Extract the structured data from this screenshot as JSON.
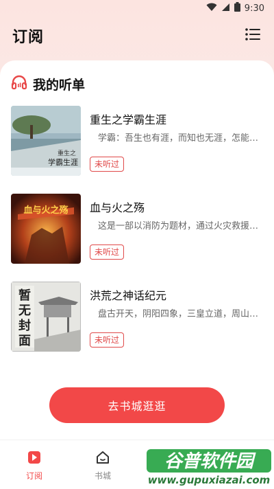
{
  "status_bar": {
    "time": "9:30",
    "icons": [
      "wifi-icon",
      "signal-icon",
      "battery-icon"
    ]
  },
  "header": {
    "title": "订阅",
    "menu_icon": "list-menu-icon"
  },
  "section": {
    "icon": "headphones-icon",
    "title": "我的听单"
  },
  "books": [
    {
      "title": "重生之学霸生涯",
      "desc": "学霸：吾生也有涯，而知也无涯，怎能不…",
      "badge": "未听过",
      "cover_text": "重生之学霸生涯"
    },
    {
      "title": "血与火之殇",
      "desc": "这是一部以消防为题材，通过火灾救援、…",
      "badge": "未听过",
      "cover_text": "血与火之殇"
    },
    {
      "title": "洪荒之神话纪元",
      "desc": "盘古开天，阴阳四象，三皇立道，周山永…",
      "badge": "未听过",
      "cover_text": "暂无封面"
    }
  ],
  "cta_label": "去书城逛逛",
  "nav": {
    "items": [
      {
        "label": "订阅",
        "icon": "bookmark-icon",
        "active": true
      },
      {
        "label": "书城",
        "icon": "home-icon",
        "active": false
      }
    ]
  },
  "watermark": {
    "line1": "谷普软件园",
    "line2": "www.gupuxiazai.com"
  },
  "colors": {
    "accent": "#f24848",
    "badge": "#e04848",
    "background": "#fbe9e7"
  }
}
